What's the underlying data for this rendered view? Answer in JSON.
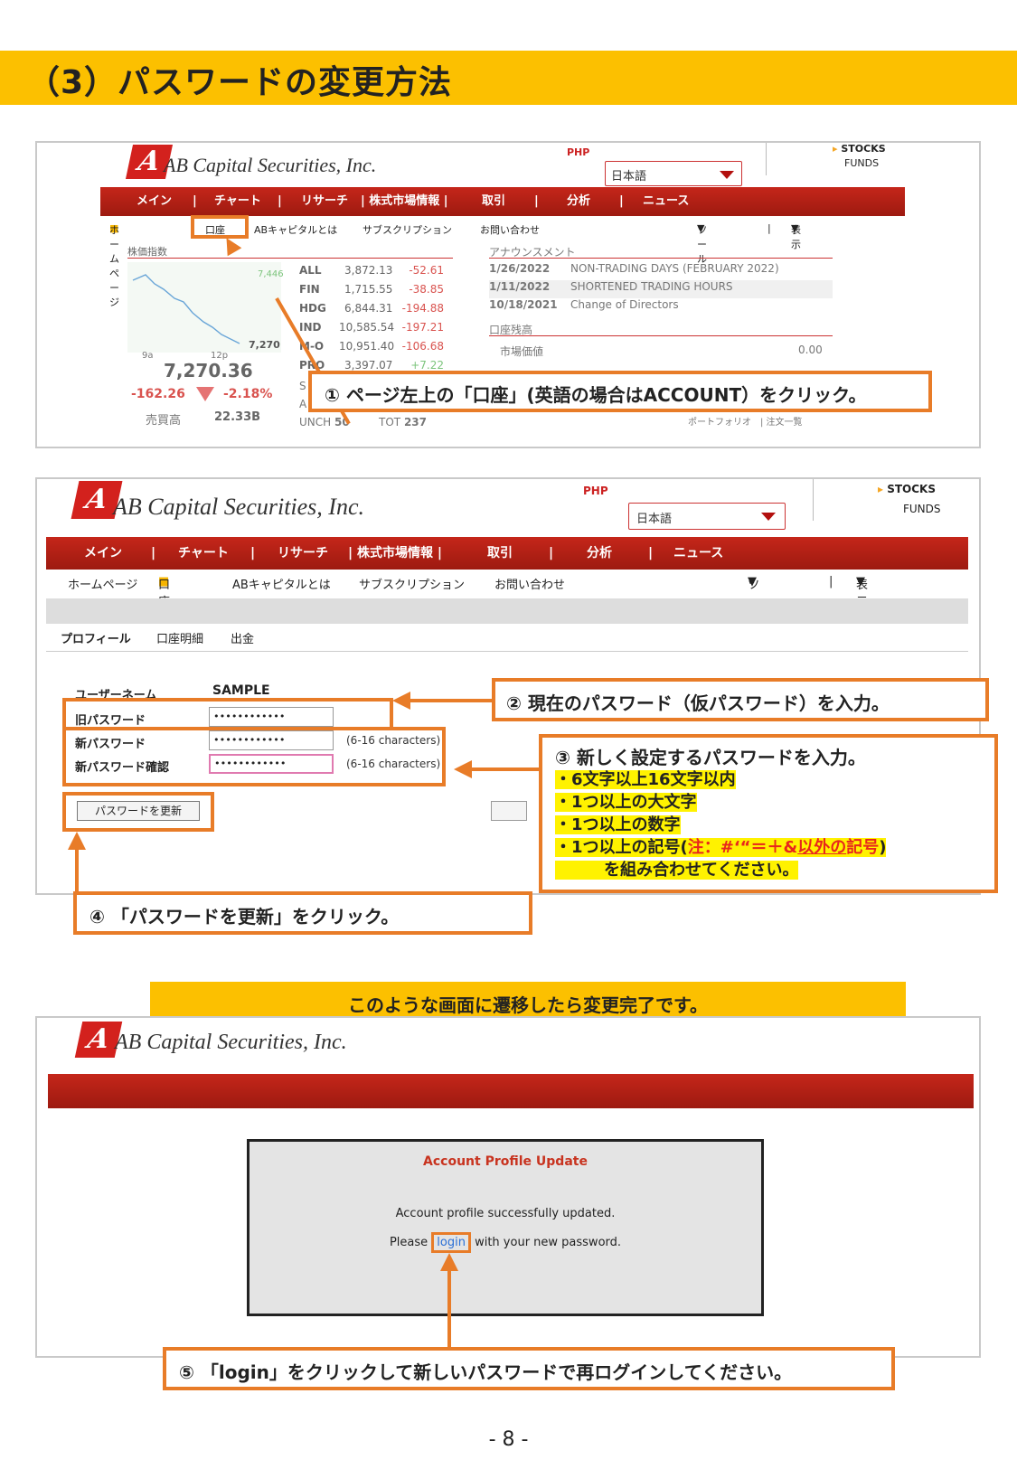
{
  "header": {
    "title": "（3）パスワードの変更方法"
  },
  "brand": {
    "logo_letter": "A",
    "name": "AB Capital Securities, Inc."
  },
  "top": {
    "php": "PHP",
    "lang": "日本語",
    "stocks": "STOCKS",
    "funds": "FUNDS"
  },
  "nav": [
    "メイン",
    "|",
    "チャート",
    "|",
    "リサーチ",
    "| 株式市場情報 |",
    "取引",
    "|",
    "分析",
    "|",
    "ニュース"
  ],
  "subnav": {
    "home": "ホームページ",
    "account": "口座",
    "about": "ABキャピタルとは",
    "subscription": "サブスクリプション",
    "contact": "お問い合わせ",
    "tools": "ツール",
    "sep": "|",
    "display": "表示"
  },
  "market": {
    "title": "株価指数",
    "index_value": "7,270.36",
    "change": "-162.26",
    "change_pct": "-2.18%",
    "turnover_label": "売買高",
    "turnover": "22.33B",
    "chart_start": "7,446",
    "chart_end": "7,270",
    "tick_9a": "9a",
    "tick_12p": "12p",
    "rows": [
      {
        "name": "ALL",
        "value": "3,872.13",
        "chg": "-52.61"
      },
      {
        "name": "FIN",
        "value": "1,715.55",
        "chg": "-38.85"
      },
      {
        "name": "HDG",
        "value": "6,844.31",
        "chg": "-194.88"
      },
      {
        "name": "IND",
        "value": "10,585.54",
        "chg": "-197.21"
      },
      {
        "name": "M-O",
        "value": "10,951.40",
        "chg": "-106.68"
      },
      {
        "name": "PRO",
        "value": "3,397.07",
        "chg": "+7.22"
      }
    ],
    "unch_label": "UNCH",
    "unch": "50",
    "tot_label": "TOT",
    "tot": "237",
    "s_label": "S",
    "a_label": "A"
  },
  "announce": {
    "title": "アナウンスメント",
    "items": [
      {
        "date": "1/26/2022",
        "text": "NON-TRADING DAYS (FEBRUARY 2022)"
      },
      {
        "date": "1/11/2022",
        "text": "SHORTENED TRADING HOURS"
      },
      {
        "date": "10/18/2021",
        "text": "Change of Directors"
      }
    ],
    "balance_title": "口座残高",
    "market_value_label": "市場価値",
    "market_value": "0.00",
    "links": "ポートフォリオ　|  注文一覧"
  },
  "step1": "① ページ左上の「口座」(英語の場合はACCOUNT）をクリック。",
  "profile": {
    "tabs": [
      "プロフィール",
      "口座明細",
      "出金"
    ],
    "username_label": "ユーザーネーム",
    "username": "SAMPLE",
    "old_pw_label": "旧パスワード",
    "new_pw_label": "新パスワード",
    "confirm_label": "新パスワード確認",
    "masked": "••••••••••••",
    "hint": "(6-16 characters)",
    "update_button": "パスワードを更新"
  },
  "step2": "② 現在のパスワード（仮パスワード）を入力。",
  "step3": {
    "title": "③ 新しく設定するパスワードを入力。",
    "rules": [
      "・6文字以上16文字以内",
      "・1つ以上の大文字",
      "・1つ以上の数字"
    ],
    "rule4_prefix": "・1つ以上の記号(",
    "rule4_note": "注：#‘“＝＋&",
    "rule4_except": "以外の",
    "rule4_sym": "記号",
    "rule4_suffix": ")",
    "rule5": "を組み合わせてください。"
  },
  "step4": "④ 「パスワードを更新」をクリック。",
  "banner": "このような画面に遷移したら変更完了です。",
  "done": {
    "title": "Account Profile Update",
    "msg": "Account profile successfully updated.",
    "please": "Please",
    "login": "login",
    "rest": "with your new password."
  },
  "step5": "⑤ 「login」をクリックして新しいパスワードで再ログインしてください。",
  "page_number": "- 8 -",
  "colors": {
    "accent": "#fcc000",
    "orange": "#e87c28",
    "red": "#c5261a"
  }
}
